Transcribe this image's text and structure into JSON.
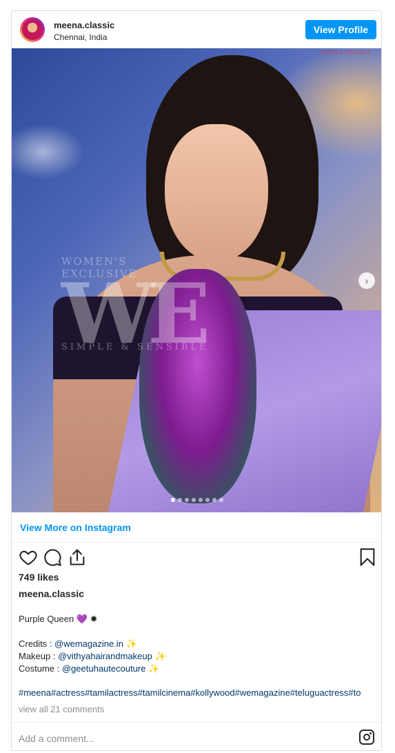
{
  "header": {
    "username": "meena.classic",
    "location": "Chennai, India",
    "view_profile_label": "View Profile"
  },
  "photo": {
    "watermark_line1": "WOMEN'S",
    "watermark_line2": "EXCLUSIVE",
    "watermark_logo": "WE",
    "watermark_tagline": "SIMPLE & SENSIBLE",
    "brand_mark": "SIMPLE & SENSIBLE",
    "carousel_count": 8,
    "carousel_active_index": 0,
    "next_icon": "chevron-right-icon"
  },
  "view_more_label": "View More on Instagram",
  "actions": {
    "icons": [
      "heart-icon",
      "comment-icon",
      "share-icon",
      "bookmark-icon"
    ]
  },
  "likes_text": "749 likes",
  "caption": {
    "username": "meena.classic",
    "title": "Purple Queen 💜 ✹",
    "credits_label": "Credits : ",
    "credits_handle": "@wemagazine.in",
    "makeup_label": "Makeup : ",
    "makeup_handle": "@vithyahairandmakeup",
    "costume_label": "Costume : ",
    "costume_handle": "@geetuhautecouture",
    "sparkle": "✨",
    "hashtags": "#meena#actress#tamilactress#tamilcinema#kollywood#wemagazine#teluguactress#to"
  },
  "comments_text": "view all 21 comments",
  "add_comment_placeholder": "Add a comment...",
  "colors": {
    "accent": "#0095f6",
    "link": "#00376b",
    "muted": "#8e8e8e",
    "border": "#dbdbdb"
  }
}
